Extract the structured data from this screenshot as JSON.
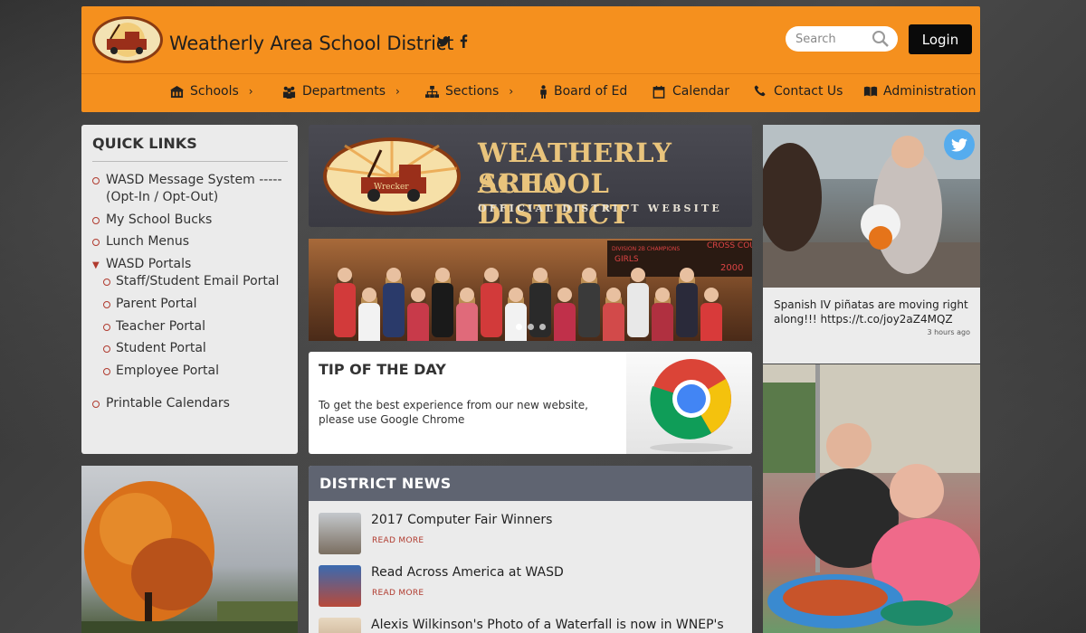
{
  "header": {
    "site_title": "Weatherly Area School District",
    "search_placeholder": "Search",
    "login_label": "Login",
    "social": [
      "twitter-icon",
      "facebook-icon"
    ]
  },
  "nav": [
    {
      "label": "Schools",
      "icon": "building-icon",
      "has_submenu": true
    },
    {
      "label": "Departments",
      "icon": "people-icon",
      "has_submenu": true
    },
    {
      "label": "Sections",
      "icon": "sitemap-icon",
      "has_submenu": true
    },
    {
      "label": "Board of Ed",
      "icon": "person-icon",
      "has_submenu": false
    },
    {
      "label": "Calendar",
      "icon": "calendar-icon",
      "has_submenu": false
    },
    {
      "label": "Contact Us",
      "icon": "phone-icon",
      "has_submenu": false
    },
    {
      "label": "Administration",
      "icon": "book-icon",
      "has_submenu": false
    }
  ],
  "quick_links": {
    "title": "QUICK LINKS",
    "items": [
      {
        "label": "WASD Message System -----",
        "label2": "(Opt-In / Opt-Out)"
      },
      {
        "label": "My School Bucks"
      },
      {
        "label": "Lunch Menus"
      },
      {
        "label": "WASD Portals",
        "expanded": true
      },
      {
        "label": "Staff/Student Email Portal"
      },
      {
        "label": "Parent Portal"
      },
      {
        "label": "Teacher Portal"
      },
      {
        "label": "Student Portal"
      },
      {
        "label": "Employee Portal"
      },
      {
        "label": "Printable Calendars"
      }
    ]
  },
  "banner": {
    "line1": "WEATHERLY AREA",
    "line2": "SCHOOL DISTRICT",
    "subtitle": "OFFICIAL DISTRICT WEBSITE",
    "logo_text": "Wrecker"
  },
  "slideshow": {
    "banner_text_1": "DIVISION 2B CHAMPIONS",
    "banner_text_2": "GIRLS",
    "banner_text_3": "CROSS COUNTRY",
    "banner_text_4": "2000",
    "slides": 3,
    "active": 0
  },
  "tip": {
    "title": "TIP OF THE DAY",
    "text": "To get the best experience from our new website, please use Google Chrome"
  },
  "news": {
    "title": "DISTRICT  NEWS",
    "read_more": "READ MORE",
    "items": [
      {
        "title": "2017 Computer Fair Winners"
      },
      {
        "title": "Read Across America at WASD"
      },
      {
        "title": "Alexis Wilkinson's Photo of a Waterfall is now in WNEP's"
      }
    ]
  },
  "tweet": {
    "text": "Spanish IV piñatas are moving right along!!! https://t.co/joy2aZ4MQZ",
    "time": "3 hours ago"
  },
  "colors": {
    "header_orange": "#f5901e",
    "accent_red": "#b03a2e",
    "twitter_blue": "#55acee",
    "news_header": "#5f6471"
  }
}
